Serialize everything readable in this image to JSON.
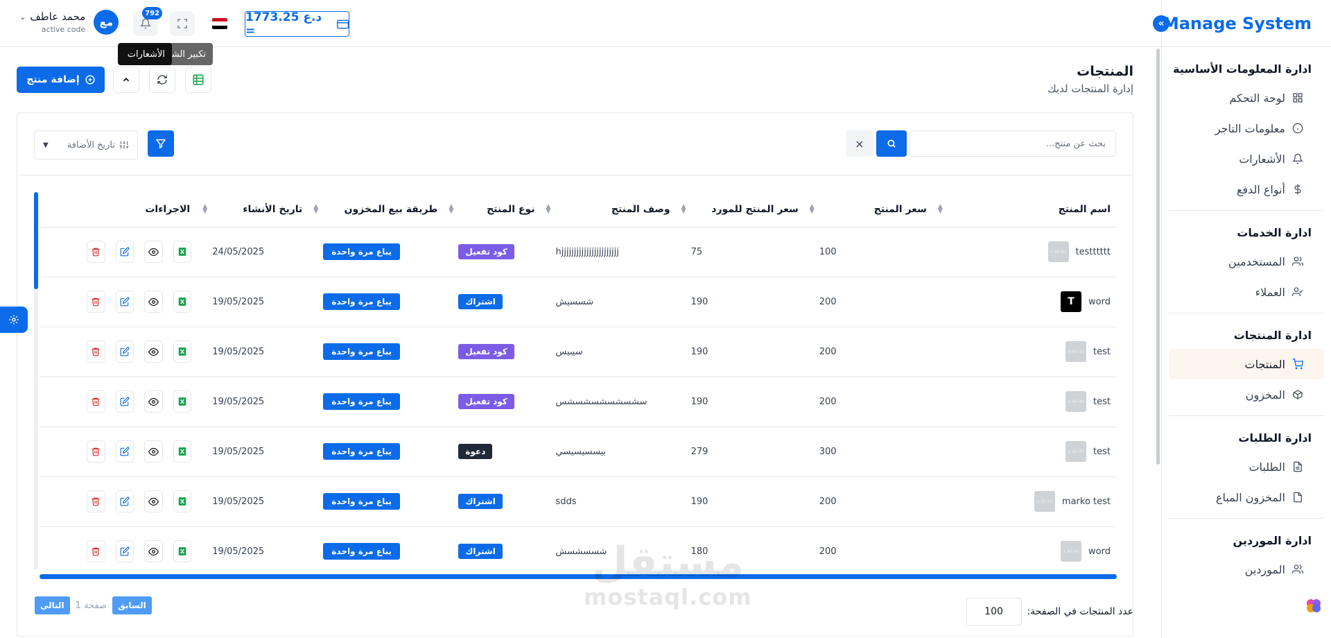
{
  "sidebar": {
    "brand": "Manage System",
    "sections": [
      {
        "title": "ادارة المعلومات الأساسية",
        "items": [
          {
            "label": "لوحة التحكم",
            "icon": "grid-icon"
          },
          {
            "label": "معلومات التاجر",
            "icon": "info-icon"
          },
          {
            "label": "الأشعارات",
            "icon": "bell-icon"
          },
          {
            "label": "أنواع الدفع",
            "icon": "dollar-icon"
          }
        ]
      },
      {
        "title": "ادارة الخدمات",
        "items": [
          {
            "label": "المستخدمين",
            "icon": "users-icon"
          },
          {
            "label": "العملاء",
            "icon": "user-check-icon"
          }
        ]
      },
      {
        "title": "ادارة المنتجات",
        "items": [
          {
            "label": "المنتجات",
            "icon": "cart-icon",
            "active": true
          },
          {
            "label": "المخزون",
            "icon": "box-icon"
          }
        ]
      },
      {
        "title": "ادارة الطلبات",
        "items": [
          {
            "label": "الطلبات",
            "icon": "file-text-icon"
          },
          {
            "label": "المخزون المباع",
            "icon": "file-icon"
          }
        ]
      },
      {
        "title": "ادارة الموردين",
        "items": [
          {
            "label": "الموردين",
            "icon": "users-icon"
          }
        ]
      }
    ]
  },
  "topbar": {
    "user_name": "محمد عاطف",
    "user_sub": "active code",
    "avatar_initials": "مع",
    "notifications_count": "792",
    "balance": "1773.25 د.ع =",
    "tooltip_fullscreen": "تكبير الشاشة",
    "tooltip_notifications": "الأشعارات"
  },
  "page": {
    "title": "المنتجات",
    "subtitle": "إدارة المنتجات لديك",
    "add_button": "إضافة منتج"
  },
  "filters": {
    "search_placeholder": "بحث عن منتج...",
    "clear_symbol": "×",
    "sort_label": "تاريخ الأضافة"
  },
  "table": {
    "headers": {
      "name": "اسم المنتج",
      "price": "سعر المنتج",
      "supplier_price": "سعر المنتج للمورد",
      "description": "وصف المنتج",
      "type": "نوع المنتج",
      "sale_method": "طريقة بيع المخزون",
      "created": "تاريخ الأنشاء",
      "actions": "الاجراءات"
    },
    "thumb_text": "40 x 40",
    "rows": [
      {
        "name": "testttttt",
        "logo": false,
        "price": "100",
        "supplier_price": "75",
        "description": "hjjjjjjjjjjjjjjjjjjjjjjj",
        "type": "كود تفعيل",
        "type_style": "purple",
        "sale": "يباع مرة واحدة",
        "created": "24/05/2025"
      },
      {
        "name": "word",
        "logo": true,
        "price": "200",
        "supplier_price": "190",
        "description": "شسسيش",
        "type": "اشتراك",
        "type_style": "blue",
        "sale": "يباع مرة واحدة",
        "created": "19/05/2025"
      },
      {
        "name": "test",
        "logo": false,
        "price": "200",
        "supplier_price": "190",
        "description": "سيبيس",
        "type": "كود تفعيل",
        "type_style": "purple",
        "sale": "يباع مرة واحدة",
        "created": "19/05/2025"
      },
      {
        "name": "test",
        "logo": false,
        "price": "200",
        "supplier_price": "190",
        "description": "سشسشسشسشسشس",
        "type": "كود تفعيل",
        "type_style": "purple",
        "sale": "يباع مرة واحدة",
        "created": "19/05/2025"
      },
      {
        "name": "test",
        "logo": false,
        "price": "300",
        "supplier_price": "279",
        "description": "بيسسيسيسي",
        "type": "دعوة",
        "type_style": "dark",
        "sale": "يباع مرة واحدة",
        "created": "19/05/2025"
      },
      {
        "name": "marko test",
        "logo": false,
        "price": "200",
        "supplier_price": "190",
        "description": "sdds",
        "type": "اشتراك",
        "type_style": "blue",
        "sale": "يباع مرة واحدة",
        "created": "19/05/2025"
      },
      {
        "name": "word",
        "logo": false,
        "price": "200",
        "supplier_price": "180",
        "description": "شسسشسش",
        "type": "اشتراك",
        "type_style": "blue",
        "sale": "يباع مرة واحدة",
        "created": "19/05/2025"
      }
    ]
  },
  "pagination": {
    "per_page_label": "عدد المنتجات في الصفحة:",
    "per_page_value": "100",
    "prev": "السابق",
    "page_info": "صفحة 1",
    "next": "التالي"
  },
  "watermark": {
    "arabic": "مستقل",
    "latin": "mostaql.com"
  },
  "colors": {
    "accent": "#0b6be8",
    "purple_tag": "#7c5ce6",
    "dark_tag": "#1f2937",
    "excel_green": "#16a34a",
    "delete_red": "#dc2626"
  }
}
